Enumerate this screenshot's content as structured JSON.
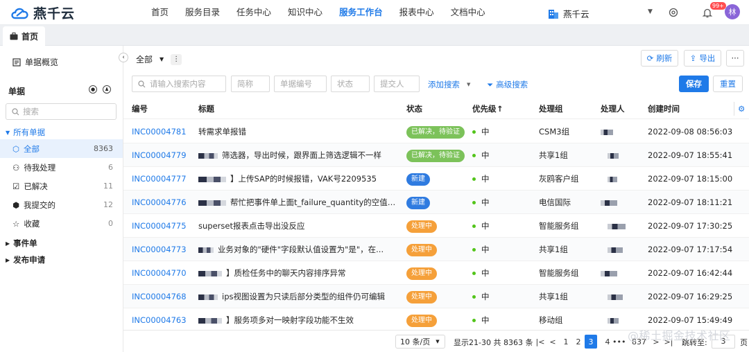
{
  "app": {
    "logo_text": "燕千云"
  },
  "nav": {
    "items": [
      "首页",
      "服务目录",
      "任务中心",
      "知识中心",
      "服务工作台",
      "报表中心",
      "文档中心"
    ],
    "active": 4
  },
  "header": {
    "org": "燕千云",
    "badge": "99+",
    "avatar": "林"
  },
  "tabs": [
    {
      "label": "首页"
    }
  ],
  "sidebar": {
    "overview": "单据概览",
    "section": "单据",
    "search_placeholder": "搜索",
    "group_all": "所有单据",
    "items": [
      {
        "label": "全部",
        "count": "8363",
        "icon": "tag-icon"
      },
      {
        "label": "待我处理",
        "count": "6",
        "icon": "user-task-icon"
      },
      {
        "label": "已解决",
        "count": "11",
        "icon": "check-square-icon"
      },
      {
        "label": "我提交的",
        "count": "12",
        "icon": "box-icon"
      },
      {
        "label": "收藏",
        "count": "0",
        "icon": "star-icon"
      }
    ],
    "group_event": "事件单",
    "group_release": "发布申请"
  },
  "toolbar": {
    "scope": "全部",
    "refresh": "刷新",
    "export": "导出"
  },
  "filters": {
    "search_placeholder": "请输入搜索内容",
    "f_short": "简称",
    "f_number": "单据编号",
    "f_status": "状态",
    "f_submitter": "提交人",
    "add_search": "添加搜索",
    "advanced": "高级搜索",
    "save": "保存",
    "reset": "重置"
  },
  "table": {
    "columns": {
      "id": "编号",
      "title": "标题",
      "status": "状态",
      "priority": "优先级",
      "sort": "↑",
      "group": "处理组",
      "handler": "处理人",
      "created": "创建时间"
    },
    "rows": [
      {
        "id": "INC00004781",
        "title": "转需求单报错",
        "status": "已解决，待验证",
        "color": "#7cc25a",
        "priority": "中",
        "group": "CSM3组",
        "time": "2022-09-08 08:56:03"
      },
      {
        "id": "INC00004779",
        "title": "筛选器，导出时候，跟界面上筛选逻辑不一样",
        "status": "已解决，待验证",
        "color": "#7cc25a",
        "priority": "中",
        "group": "共享1组",
        "time": "2022-09-07 18:55:41"
      },
      {
        "id": "INC00004777",
        "title": "】上传SAP的时候报错，VAK号2209535",
        "status": "新建",
        "color": "#2f7be0",
        "priority": "中",
        "group": "灰鸥客户组",
        "time": "2022-09-07 18:15:00"
      },
      {
        "id": "INC00004776",
        "title": "帮忙把事件单上面t_failure_quantity的空值填上...",
        "status": "新建",
        "color": "#2f7be0",
        "priority": "中",
        "group": "电信国际",
        "time": "2022-09-07 18:11:21"
      },
      {
        "id": "INC00004775",
        "title": "superset报表点击导出没反应",
        "status": "处理中",
        "color": "#f5a03a",
        "priority": "中",
        "group": "智能服务组",
        "time": "2022-09-07 17:30:25"
      },
      {
        "id": "INC00004773",
        "title": "业务对象的\"硬件\"字段默认值设置为\"是\"，在...",
        "status": "处理中",
        "color": "#f5a03a",
        "priority": "中",
        "group": "共享1组",
        "time": "2022-09-07 17:17:54"
      },
      {
        "id": "INC00004770",
        "title": "】质检任务中的聊天内容排序异常",
        "status": "处理中",
        "color": "#f5a03a",
        "priority": "中",
        "group": "智能服务组",
        "time": "2022-09-07 16:42:44"
      },
      {
        "id": "INC00004768",
        "title": "ips视图设置为只读后部分类型的组件仍可编辑",
        "status": "处理中",
        "color": "#f5a03a",
        "priority": "中",
        "group": "共享1组",
        "time": "2022-09-07 16:29:25"
      },
      {
        "id": "INC00004763",
        "title": "】服务项多对一映射字段功能不生效",
        "status": "处理中",
        "color": "#f5a03a",
        "priority": "中",
        "group": "移动组",
        "time": "2022-09-07 15:49:49"
      }
    ]
  },
  "pagination": {
    "page_size": "10 条/页",
    "total": "显示21-30 共 8363 条",
    "pages": [
      "1",
      "2",
      "3",
      "4",
      "•••",
      "837"
    ],
    "current": "3",
    "jump_label": "跳转至:",
    "jump_value": "3",
    "page_unit": "页"
  },
  "watermark": "@稀土掘金技术社区"
}
